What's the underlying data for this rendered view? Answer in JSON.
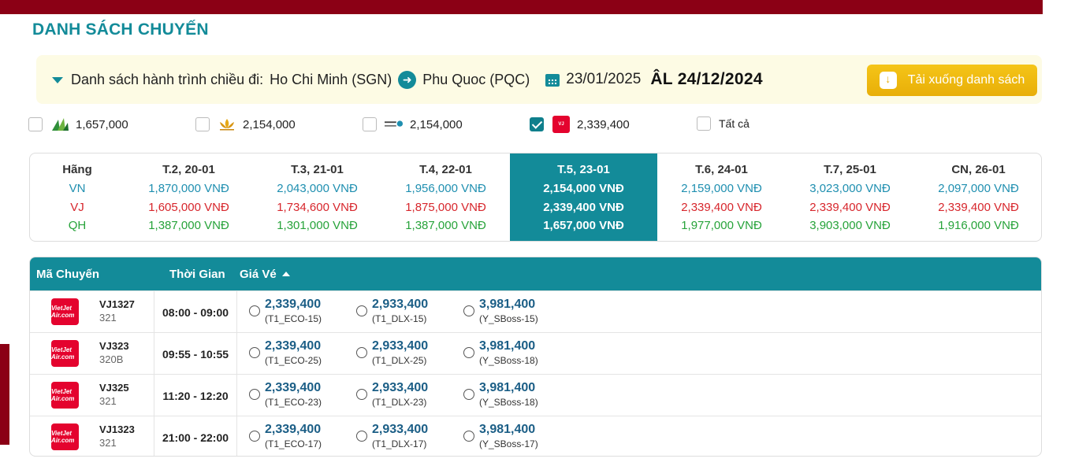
{
  "page_title": "DANH SÁCH CHUYẾN",
  "route": {
    "label": "Danh sách hành trình chiều đi:",
    "origin": "Ho Chi Minh (SGN)",
    "destination": "Phu Quoc (PQC)",
    "date": "23/01/2025",
    "lunar_date": "ÂL 24/12/2024",
    "download_label": "Tải xuống danh sách"
  },
  "airline_filters": [
    {
      "airline_icon": "bamboo-airways-logo",
      "price": "1,657,000",
      "checked": false
    },
    {
      "airline_icon": "vietnam-airlines-logo",
      "price": "2,154,000",
      "checked": false
    },
    {
      "airline_icon": "pacific-airlines-logo",
      "price": "2,154,000",
      "checked": false
    },
    {
      "airline_icon": "vietjet-logo",
      "price": "2,339,400",
      "checked": true
    },
    {
      "label": "Tất cả",
      "checked": false
    }
  ],
  "price_calendar": {
    "header_airline": "Hãng",
    "airlines": [
      "VN",
      "VJ",
      "QH"
    ],
    "selected_index": 3,
    "days": [
      {
        "label": "T.2, 20-01",
        "vn": "1,870,000 VNĐ",
        "vj": "1,605,000 VNĐ",
        "qh": "1,387,000 VNĐ"
      },
      {
        "label": "T.3, 21-01",
        "vn": "2,043,000 VNĐ",
        "vj": "1,734,600 VNĐ",
        "qh": "1,301,000 VNĐ"
      },
      {
        "label": "T.4, 22-01",
        "vn": "1,956,000 VNĐ",
        "vj": "1,875,000 VNĐ",
        "qh": "1,387,000 VNĐ"
      },
      {
        "label": "T.5, 23-01",
        "vn": "2,154,000 VNĐ",
        "vj": "2,339,400 VNĐ",
        "qh": "1,657,000 VNĐ"
      },
      {
        "label": "T.6, 24-01",
        "vn": "2,159,000 VNĐ",
        "vj": "2,339,400 VNĐ",
        "qh": "1,977,000 VNĐ"
      },
      {
        "label": "T.7, 25-01",
        "vn": "3,023,000 VNĐ",
        "vj": "2,339,400 VNĐ",
        "qh": "3,903,000 VNĐ"
      },
      {
        "label": "CN, 26-01",
        "vn": "2,097,000 VNĐ",
        "vj": "2,339,400 VNĐ",
        "qh": "1,916,000 VNĐ"
      }
    ]
  },
  "flights_table": {
    "headers": {
      "code": "Mã Chuyến",
      "time": "Thời Gian",
      "price": "Giá Vé"
    },
    "sort": "price-ascending",
    "logo_text": "VietJet Air.com",
    "rows": [
      {
        "flight_no": "VJ1327",
        "aircraft": "321",
        "time": "08:00 - 09:00",
        "fares": [
          {
            "price": "2,339,400",
            "class": "(T1_ECO-15)"
          },
          {
            "price": "2,933,400",
            "class": "(T1_DLX-15)"
          },
          {
            "price": "3,981,400",
            "class": "(Y_SBoss-15)"
          }
        ]
      },
      {
        "flight_no": "VJ323",
        "aircraft": "320B",
        "time": "09:55 - 10:55",
        "fares": [
          {
            "price": "2,339,400",
            "class": "(T1_ECO-25)"
          },
          {
            "price": "2,933,400",
            "class": "(T1_DLX-25)"
          },
          {
            "price": "3,981,400",
            "class": "(Y_SBoss-18)"
          }
        ]
      },
      {
        "flight_no": "VJ325",
        "aircraft": "321",
        "time": "11:20 - 12:20",
        "fares": [
          {
            "price": "2,339,400",
            "class": "(T1_ECO-23)"
          },
          {
            "price": "2,933,400",
            "class": "(T1_DLX-23)"
          },
          {
            "price": "3,981,400",
            "class": "(Y_SBoss-18)"
          }
        ]
      },
      {
        "flight_no": "VJ1323",
        "aircraft": "321",
        "time": "21:00 - 22:00",
        "fares": [
          {
            "price": "2,339,400",
            "class": "(T1_ECO-17)"
          },
          {
            "price": "2,933,400",
            "class": "(T1_DLX-17)"
          },
          {
            "price": "3,981,400",
            "class": "(Y_SBoss-17)"
          }
        ]
      }
    ]
  },
  "colors": {
    "accent": "#138b99",
    "brand_dark": "#8b0015",
    "button": "#f0b90b",
    "vj_red": "#d7262c",
    "vn_blue": "#1f8fb0",
    "qh_green": "#27a33a"
  }
}
